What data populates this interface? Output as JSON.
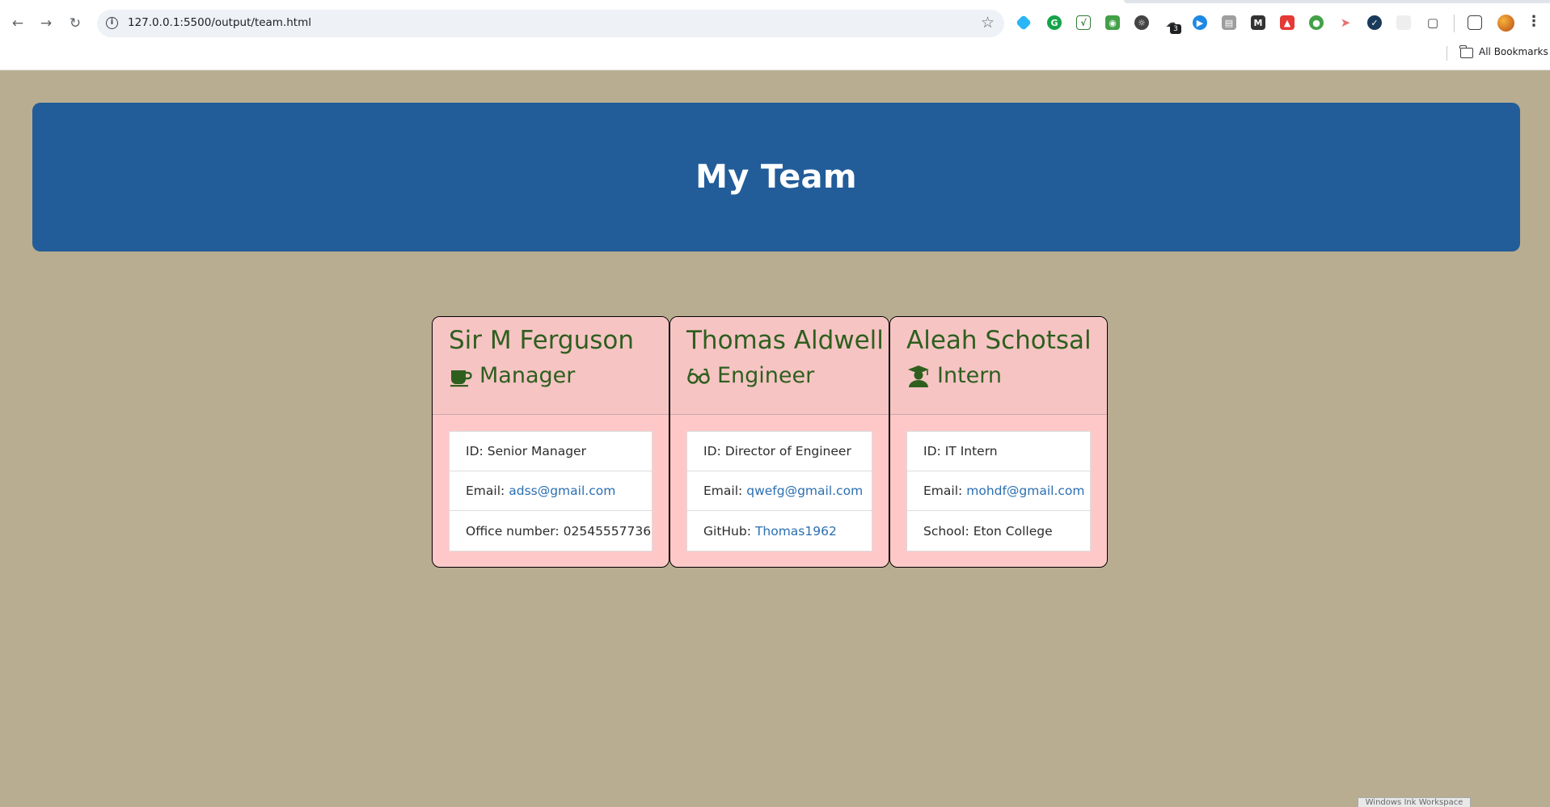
{
  "browser": {
    "url": "127.0.0.1:5500/output/team.html",
    "extension_badge": "3",
    "bookmarks_label": "All Bookmarks"
  },
  "page": {
    "title": "My Team"
  },
  "team": [
    {
      "name": "Sir M Ferguson",
      "role": "Manager",
      "icon": "coffee-icon",
      "id_label": "ID:",
      "id": "Senior Manager",
      "email_label": "Email:",
      "email": "adss@gmail.com",
      "extra_label": "Office number:",
      "extra": "02545557736",
      "extra_is_link": false
    },
    {
      "name": "Thomas Aldwell",
      "role": "Engineer",
      "icon": "glasses-icon",
      "id_label": "ID:",
      "id": "Director of Engineer",
      "email_label": "Email:",
      "email": "qwefg@gmail.com",
      "extra_label": "GitHub:",
      "extra": "Thomas1962",
      "extra_is_link": true
    },
    {
      "name": "Aleah Schotsal",
      "role": "Intern",
      "icon": "graduate-icon",
      "id_label": "ID:",
      "id": "IT Intern",
      "email_label": "Email:",
      "email": "mohdf@gmail.com",
      "extra_label": "School:",
      "extra": "Eton College",
      "extra_is_link": false
    }
  ],
  "taskbar": {
    "ink_label": "Windows Ink Workspace"
  },
  "colors": {
    "background": "#b8ad90",
    "hero": "#225d99",
    "card": "#ffc8c8",
    "text_green": "#2e5f1e",
    "link": "#2b6fb1"
  }
}
